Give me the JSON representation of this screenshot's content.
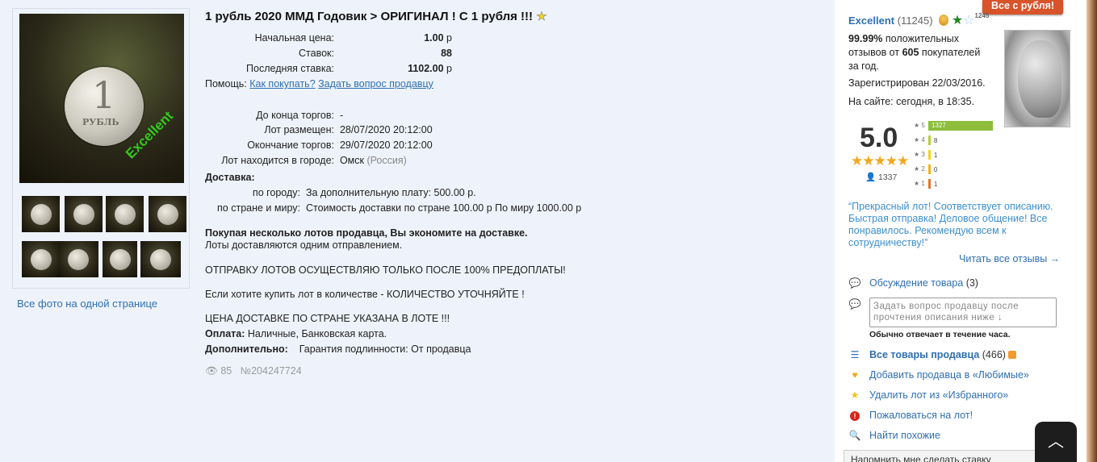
{
  "lot": {
    "title": "1 рубль 2020 ММД Годовик > ОРИГИНАЛ ! С 1 рубля !!!",
    "start_price_label": "Начальная цена:",
    "start_price": "1.00",
    "bids_label": "Ставок:",
    "bids": "88",
    "last_bid_label": "Последняя ставка:",
    "last_bid": "1102.00",
    "currency": "р",
    "help_label": "Помощь:",
    "help_how_to_buy": "Как покупать?",
    "help_ask_seller": "Задать вопрос продавцу",
    "time_left_label": "До конца торгов:",
    "time_left": "-",
    "placed_label": "Лот размещен:",
    "placed": "28/07/2020 20:12:00",
    "ends_label": "Окончание торгов:",
    "ends": "29/07/2020 20:12:00",
    "city_label": "Лот находится в городе:",
    "city": "Омск",
    "country": "(Россия)",
    "delivery_label": "Доставка:",
    "delivery_city_label": "по городу:",
    "delivery_city": "За дополнительную плату: 500.00 р.",
    "delivery_world_label": "по стране и миру:",
    "delivery_world": "Стоимость доставки по стране 100.00 р По миру 1000.00 р",
    "combine_bold": "Покупая несколько лотов продавца, Вы экономите на доставке.",
    "combine_text": "Лоты доставляются одним отправлением.",
    "note1": "ОТПРАВКУ ЛОТОВ ОСУЩЕСТВЛЯЮ ТОЛЬКО ПОСЛЕ 100% ПРЕДОПЛАТЫ!",
    "note2": "Если хотите купить лот в количестве - КОЛИЧЕСТВО УТОЧНЯЙТЕ !",
    "note3": "ЦЕНА ДОСТАВКЕ ПО СТРАНЕ УКАЗАНА В ЛОТЕ !!!",
    "payment_label": "Оплата:",
    "payment": "Наличные, Банковская карта.",
    "extra_label": "Дополнительно:",
    "extra": "Гарантия подлинности: От продавца",
    "views": "85",
    "lot_number": "№204247724"
  },
  "gallery": {
    "watermark": "Excellent",
    "coin_value": "1",
    "coin_word": "РУБЛЬ",
    "all_photos_link": "Все фото на одной странице"
  },
  "seller": {
    "all_button": "Все с рубля!",
    "name": "Excellent",
    "count": "(11245)",
    "star_small": "1245",
    "positive_pct": "99.99%",
    "positive_text_1": "положительных",
    "positive_text_2": "отзывов от",
    "buyers": "605",
    "positive_text_3": "покупателей",
    "positive_text_4": "за год.",
    "registered": "Зарегистрирован 22/03/2016.",
    "online": "На сайте: сегодня, в 18:35.",
    "score": "5.0",
    "votes": "1337",
    "rating_bars": [
      {
        "stars": "★ 5",
        "count": "1327",
        "fraction": 1.0,
        "color": "#8dbd3a"
      },
      {
        "stars": "★ 4",
        "count": "8",
        "fraction": 0.03,
        "color": "#b5cf3c"
      },
      {
        "stars": "★ 3",
        "count": "1",
        "fraction": 0.02,
        "color": "#f0d51e"
      },
      {
        "stars": "★ 2",
        "count": "0",
        "fraction": 0.02,
        "color": "#f2b21a"
      },
      {
        "stars": "★ 1",
        "count": "1",
        "fraction": 0.02,
        "color": "#e8732a"
      }
    ],
    "review_quote": "“Прекрасный лот! Соответствует описанию. Быстрая отправка! Деловое общение! Все понравилось. Рекомендую всем к сотрудничеству!”",
    "read_all_reviews": "Читать все отзывы →"
  },
  "actions": {
    "discussion": "Обсуждение товара",
    "discussion_count": "(3)",
    "ask_placeholder": "Задать вопрос продавцу после прочтения описания ниже ↓",
    "ask_note": "Обычно отвечает в течение часа.",
    "all_items": "Все товары продавца",
    "all_items_count": "(466)",
    "add_favorite_seller": "Добавить продавца в «Любимые»",
    "remove_favorite_lot": "Удалить лот из «Избранного»",
    "complain": "Пожаловаться на лот!",
    "find_similar": "Найти похожие",
    "remind_bid": "Напомнить мне сделать ставку"
  },
  "colors": {
    "link": "#2f6fb3",
    "accent_button": "#d9532a",
    "quote": "#3b8fd0",
    "page_bg": "#eef3fb"
  }
}
